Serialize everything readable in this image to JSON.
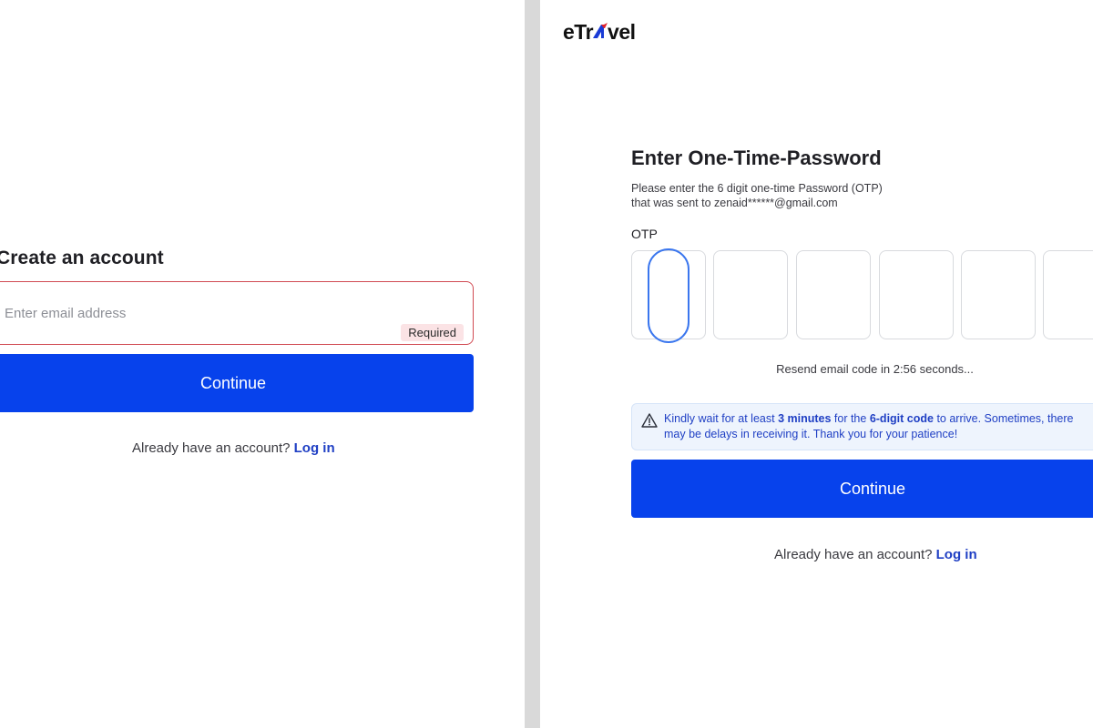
{
  "left": {
    "title": "Create an account",
    "email": {
      "placeholder": "Enter email address",
      "value": "",
      "badge": "Required"
    },
    "continue_label": "Continue",
    "login_prompt": "Already have an account?",
    "login_link": "Log in"
  },
  "right": {
    "logo": {
      "prefix": "eTr",
      "suffix": "vel"
    },
    "title": "Enter One-Time-Password",
    "desc_line1": "Please enter the 6 digit one-time Password (OTP)",
    "desc_line2": "that was sent to zenaid******@gmail.com",
    "otp_label": "OTP",
    "otp_digits": [
      "",
      "",
      "",
      "",
      "",
      ""
    ],
    "resend": "Resend email code in 2:56 seconds...",
    "notice": {
      "t1": "Kindly wait for at least ",
      "b1": "3 minutes",
      "t2": " for the ",
      "b2": "6-digit code",
      "t3": " to arrive. Sometimes, there",
      "t4": "may be delays in receiving it. Thank you for your patience!",
      "icon": "warning-triangle-icon"
    },
    "continue_label": "Continue",
    "login_prompt": "Already have an account?",
    "login_link": "Log in"
  },
  "colors": {
    "primary": "#0742ec",
    "link": "#1f3fc4",
    "error_border": "#d14a52",
    "logo_accent": "#e0222b"
  }
}
